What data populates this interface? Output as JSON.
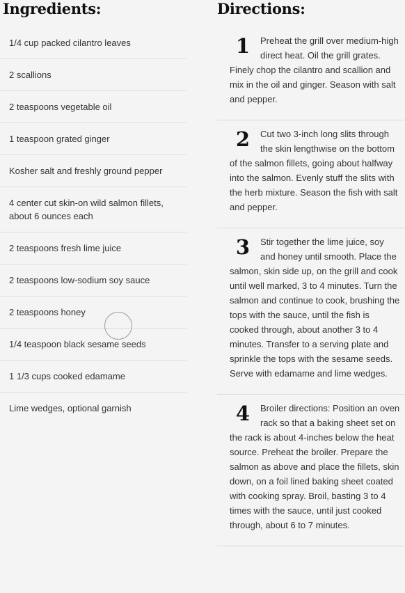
{
  "ingredients": {
    "heading": "Ingredients:",
    "items": [
      "1/4 cup packed cilantro leaves",
      "2 scallions",
      "2 teaspoons vegetable oil",
      "1 teaspoon grated ginger",
      "Kosher salt and freshly ground pepper",
      "4 center cut skin-on wild salmon fillets, about 6 ounces each",
      "2 teaspoons fresh lime juice",
      "2 teaspoons low-sodium soy sauce",
      "2 teaspoons honey",
      "1/4 teaspoon black sesame seeds",
      "1 1/3 cups cooked edamame",
      "Lime wedges, optional garnish"
    ]
  },
  "directions": {
    "heading": "Directions:",
    "steps": [
      {
        "number": "1",
        "text": "Preheat the grill over medium-high direct heat. Oil the grill grates. Finely chop the cilantro and scallion and mix in the oil and ginger. Season with salt and pepper."
      },
      {
        "number": "2",
        "text": "Cut two 3-inch long slits through the skin lengthwise on the bottom of the salmon fillets, going about halfway into the salmon. Evenly stuff the slits with the herb mixture. Season the fish with salt and pepper."
      },
      {
        "number": "3",
        "text": "Stir together the lime juice, soy and honey until smooth. Place the salmon, skin side up, on the grill and cook until well marked, 3 to 4 minutes. Turn the salmon and continue to cook, brushing the tops with the sauce, until the fish is cooked through, about another 3 to 4 minutes. Transfer to a serving plate and sprinkle the tops with the sesame seeds. Serve with edamame and lime wedges."
      },
      {
        "number": "4",
        "text": "Broiler directions: Position an oven rack so that a baking sheet set on the rack is about 4-inches below the heat source. Preheat the broiler. Prepare the salmon as above and place the fillets, skin down, on a foil lined baking sheet coated with cooking spray. Broil, basting 3 to 4 times with the sauce, until just cooked through, about 6 to 7 minutes."
      }
    ]
  }
}
